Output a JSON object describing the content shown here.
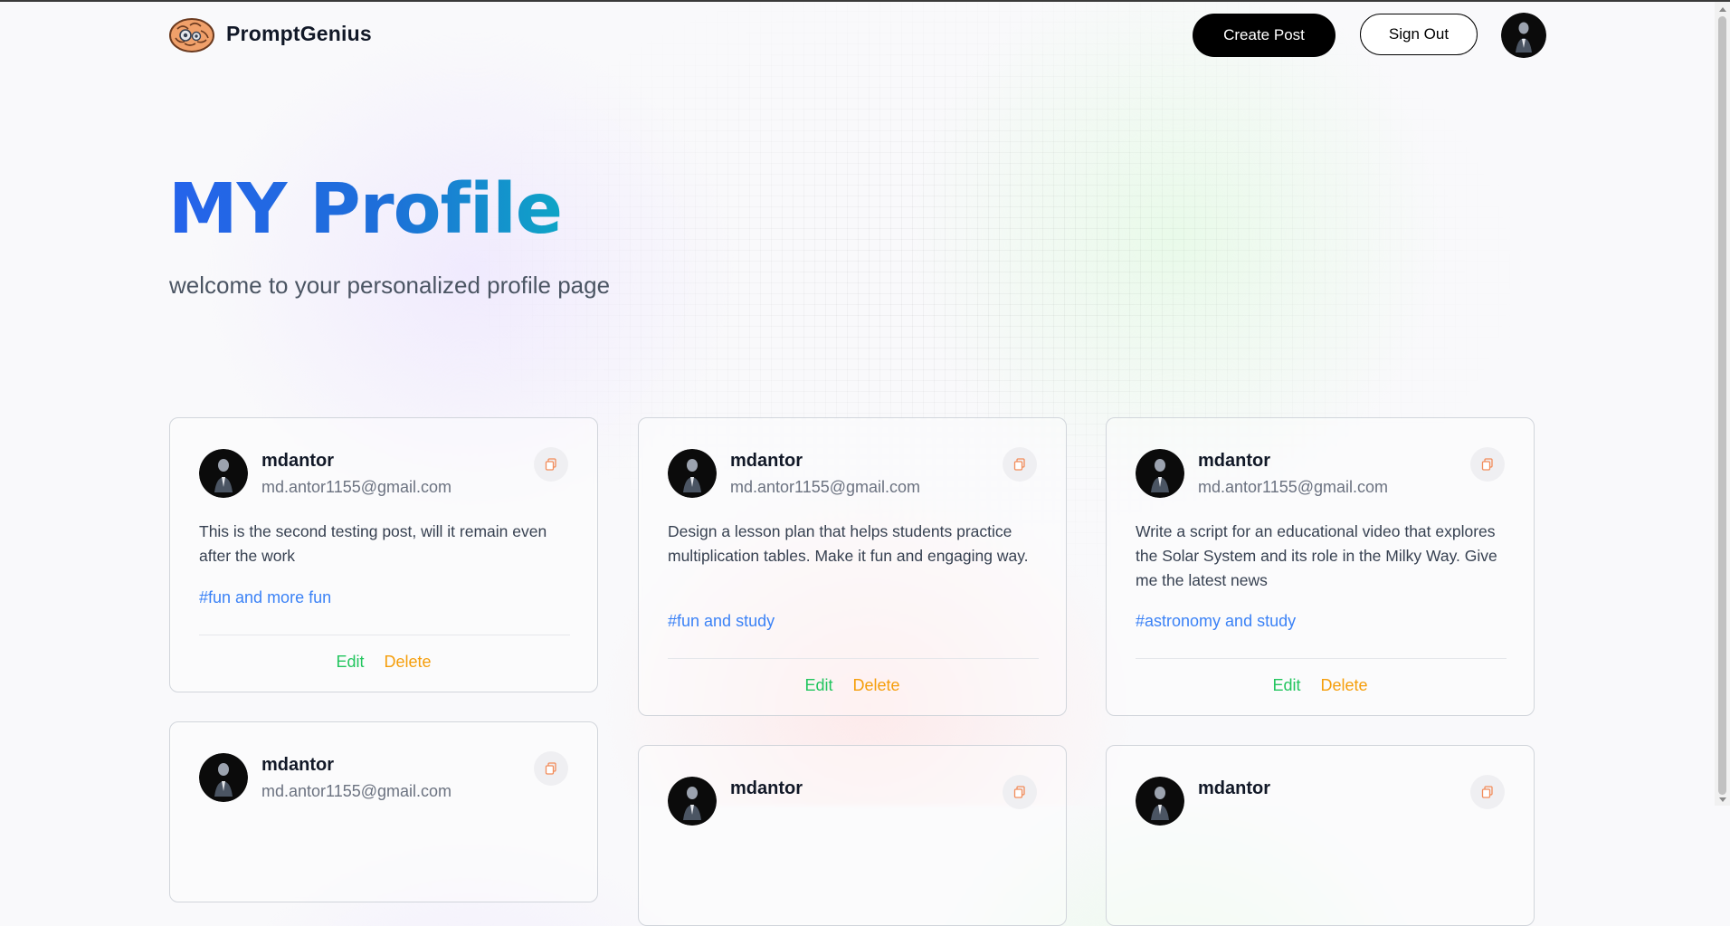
{
  "nav": {
    "brand": "PromptGenius",
    "create_label": "Create Post",
    "signout_label": "Sign Out"
  },
  "hero": {
    "title": "MY Profile",
    "subtitle": "welcome to your personalized profile page"
  },
  "posts": [
    {
      "username": "mdantor",
      "email": "md.antor1155@gmail.com",
      "text": "This is the second testing post, will it remain even after the work",
      "tag": "#fun and more fun",
      "edit_label": "Edit",
      "delete_label": "Delete"
    },
    {
      "username": "mdantor",
      "email": "md.antor1155@gmail.com",
      "text": "Design a lesson plan that helps students practice multiplication tables. Make it fun and engaging way.",
      "tag": "#fun and study",
      "edit_label": "Edit",
      "delete_label": "Delete"
    },
    {
      "username": "mdantor",
      "email": "md.antor1155@gmail.com",
      "text": "Write a script for an educational video that explores the Solar System and its role in the Milky Way. Give me the latest news",
      "tag": "#astronomy and study",
      "edit_label": "Edit",
      "delete_label": "Delete"
    },
    {
      "username": "mdantor",
      "email": "md.antor1155@gmail.com"
    },
    {
      "username": "mdantor"
    },
    {
      "username": "mdantor"
    }
  ],
  "colors": {
    "edit": "#22c55e",
    "delete": "#f59e0b",
    "tag": "#3b82f6",
    "primary_button": "#000000"
  },
  "icons": {
    "logo": "brain-gear-logo",
    "copy": "copy-icon",
    "avatar": "user-avatar"
  }
}
